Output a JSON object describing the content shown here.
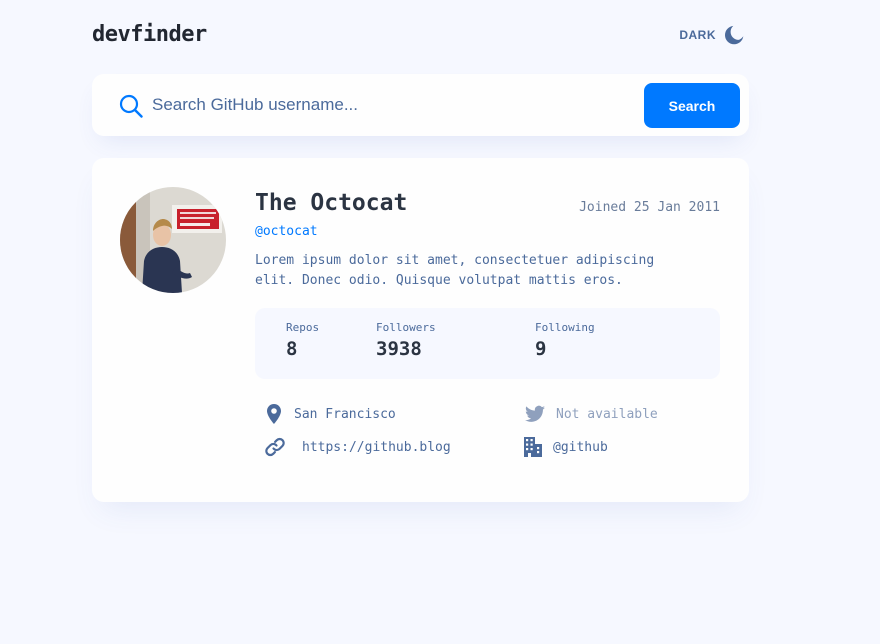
{
  "app": {
    "logo": "devfinder"
  },
  "theme": {
    "label": "DARK",
    "icon": "moon-icon"
  },
  "search": {
    "placeholder": "Search GitHub username...",
    "value": "",
    "button_label": "Search",
    "icon": "search-icon"
  },
  "profile": {
    "name": "The Octocat",
    "joined": "Joined 25 Jan 2011",
    "handle": "@octocat",
    "bio": "Lorem ipsum dolor sit amet, consectetuer adipiscing elit. Donec odio. Quisque volutpat mattis eros.",
    "stats": [
      {
        "label": "Repos",
        "value": "8"
      },
      {
        "label": "Followers",
        "value": "3938"
      },
      {
        "label": "Following",
        "value": "9"
      }
    ],
    "links": {
      "location": {
        "icon": "location-pin-icon",
        "text": "San Francisco"
      },
      "twitter": {
        "icon": "twitter-icon",
        "text": "Not available"
      },
      "website": {
        "icon": "link-icon",
        "text": "https://github.blog"
      },
      "company": {
        "icon": "building-icon",
        "text": "@github"
      }
    }
  },
  "colors": {
    "accent": "#0079ff",
    "background": "#f6f8ff",
    "card": "#fefefe",
    "text": "#4b6a9b",
    "heading": "#2b3442",
    "muted": "#8fa0bd"
  }
}
